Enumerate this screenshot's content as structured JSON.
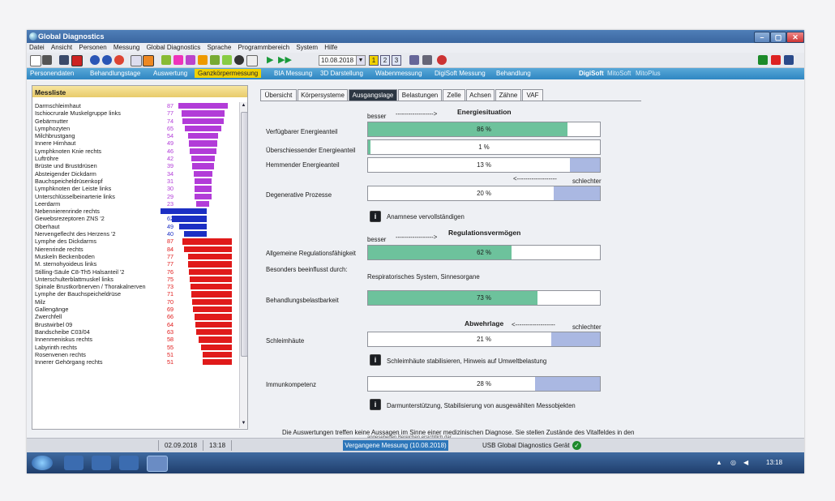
{
  "window": {
    "title": "Global Diagnostics",
    "buttons": [
      "–",
      "▢",
      "✕"
    ]
  },
  "menu": [
    "Datei",
    "Ansicht",
    "Personen",
    "Messung",
    "Global Diagnostics",
    "Sprache",
    "Programmbereich",
    "System",
    "Hilfe"
  ],
  "toolbar": {
    "date": "10.08.2018",
    "pages": [
      "1",
      "2",
      "3"
    ]
  },
  "nav": {
    "tabs": [
      "Personendaten",
      "Behandlungstage",
      "Auswertung",
      "Ganzkörpermessung",
      "BIA Messung",
      "3D Darstellung",
      "Wabenmessung",
      "DigiSoft Messung",
      "Behandlung"
    ],
    "active": "Ganzkörpermessung",
    "right": [
      "DigiSoft",
      "MitoSoft",
      "MitoPlus"
    ]
  },
  "messliste": {
    "title": "Messliste",
    "rows": [
      {
        "name": "Darmschleimhaut",
        "value": 87,
        "color": "#b23cd8"
      },
      {
        "name": "Ischiocrurale Muskelgruppe links",
        "value": 77,
        "color": "#b23cd8"
      },
      {
        "name": "Gebärmutter",
        "value": 74,
        "color": "#b23cd8"
      },
      {
        "name": "Lymphozyten",
        "value": 65,
        "color": "#b23cd8"
      },
      {
        "name": "Milchbrustgang",
        "value": 54,
        "color": "#b23cd8"
      },
      {
        "name": "Innere Hirnhaut",
        "value": 49,
        "color": "#b23cd8"
      },
      {
        "name": "Lymphknoten Knie rechts",
        "value": 46,
        "color": "#b23cd8"
      },
      {
        "name": "Luftröhre",
        "value": 42,
        "color": "#b23cd8"
      },
      {
        "name": "Brüste und Brustdrüsen",
        "value": 39,
        "color": "#b23cd8"
      },
      {
        "name": "Absteigender Dickdarm",
        "value": 34,
        "color": "#b23cd8"
      },
      {
        "name": "Bauchspeicheldrüsenkopf",
        "value": 31,
        "color": "#b23cd8"
      },
      {
        "name": "Lymphknoten der Leiste links",
        "value": 30,
        "color": "#b23cd8"
      },
      {
        "name": "Unterschlüsselbeinarterie links",
        "value": 29,
        "color": "#b23cd8"
      },
      {
        "name": "Leerdarm",
        "value": 23,
        "color": "#b23cd8"
      },
      {
        "name": "Nebennierenrinde rechts",
        "value": 82,
        "color": "#1c2fc4"
      },
      {
        "name": "Gewebsrezeptoren ZNS '2",
        "value": 62,
        "color": "#1c2fc4"
      },
      {
        "name": "Oberhaut",
        "value": 49,
        "color": "#1c2fc4"
      },
      {
        "name": "Nervengeflecht des Herzens '2",
        "value": 40,
        "color": "#1c2fc4"
      },
      {
        "name": "Lymphe des Dickdarms",
        "value": 87,
        "color": "#e01a1a"
      },
      {
        "name": "Nierenrinde rechts",
        "value": 84,
        "color": "#e01a1a"
      },
      {
        "name": "Muskeln Beckenboden",
        "value": 77,
        "color": "#e01a1a"
      },
      {
        "name": "M. sternohyoideus links",
        "value": 77,
        "color": "#e01a1a"
      },
      {
        "name": "Stilling-Säule C8-Th5 Halsanteil '2",
        "value": 76,
        "color": "#e01a1a"
      },
      {
        "name": "Unterschulterblattmuskel links",
        "value": 75,
        "color": "#e01a1a"
      },
      {
        "name": "Spinale Brustkorbnerven / Thorakalnerven",
        "value": 73,
        "color": "#e01a1a"
      },
      {
        "name": "Lymphe der Bauchspeicheldrüse",
        "value": 71,
        "color": "#e01a1a"
      },
      {
        "name": "Milz",
        "value": 70,
        "color": "#e01a1a"
      },
      {
        "name": "Gallengänge",
        "value": 69,
        "color": "#e01a1a"
      },
      {
        "name": "Zwerchfell",
        "value": 66,
        "color": "#e01a1a"
      },
      {
        "name": "Brustwirbel 09",
        "value": 64,
        "color": "#e01a1a"
      },
      {
        "name": "Bandscheibe C03/04",
        "value": 63,
        "color": "#e01a1a"
      },
      {
        "name": "Innenmeniskus rechts",
        "value": 58,
        "color": "#e01a1a"
      },
      {
        "name": "Labyrinth rechts",
        "value": 55,
        "color": "#e01a1a"
      },
      {
        "name": "Rosenvenen rechts",
        "value": 51,
        "color": "#e01a1a"
      },
      {
        "name": "Innerer Gehörgang rechts",
        "value": 51,
        "color": "#e01a1a"
      }
    ]
  },
  "subtabs": [
    "Übersicht",
    "Körpersysteme",
    "Ausgangslage",
    "Belastungen",
    "Zelle",
    "Achsen",
    "Zähne",
    "VAF"
  ],
  "subtab_active": "Ausgangslage",
  "energie": {
    "title": "Energiesituation",
    "besser": "besser",
    "arrow_right": "------------------>",
    "arrow_left": "<-------------------",
    "schlechter": "schlechter",
    "items": [
      {
        "label": "Verfügbarer Energieanteil",
        "pct": "86 %",
        "value": 86,
        "kind": "green"
      },
      {
        "label": "Überschiessender Energieanteil",
        "pct": "1 %",
        "value": 1,
        "kind": "green"
      },
      {
        "label": "Hemmender Energieanteil",
        "pct": "13 %",
        "value": 13,
        "kind": "blue"
      },
      {
        "label": "Degenerative Prozesse",
        "pct": "20 %",
        "value": 20,
        "kind": "blue"
      }
    ],
    "note": "Anamnese vervollständigen"
  },
  "regulation": {
    "title": "Regulationsvermögen",
    "besser": "besser",
    "arrow_right": "------------------>",
    "allgemein": {
      "label": "Allgemeine Regulationsfähigkeit",
      "pct": "62 %",
      "value": 62
    },
    "beeinflusst_label": "Besonders beeinflusst durch:",
    "beeinflusst_value": "Respiratorisches System, Sinnesorgane",
    "belastbarkeit": {
      "label": "Behandlungsbelastbarkeit",
      "pct": "73 %",
      "value": 73
    }
  },
  "abwehr": {
    "title": "Abwehrlage",
    "arrow_left": "<-------------------",
    "schlechter": "schlechter",
    "schleimhaeute": {
      "label": "Schleimhäute",
      "pct": "21 %",
      "value": 21
    },
    "note1": "Schleimhäute stabilisieren, Hinweis auf Umweltbelastung",
    "immun": {
      "label": "Immunkompetenz",
      "pct": "28 %",
      "value": 28
    },
    "note2": "Darmunterstützung, Stabilisierung von ausgewählten Messobjekten"
  },
  "disclaimer": {
    "line1": "Die Auswertungen treffen keine Aussagen im Sinne einer medizinischen Diagnose. Sie stellen Zustände des Vitalfeldes in den",
    "line2": "angesehenen Bereichen ersichtlich dar"
  },
  "status": {
    "date": "02.09.2018",
    "time": "13:18",
    "measurement": "Vergangene Messung (10.08.2018)",
    "device": "USB Global Diagnostics Gerät"
  },
  "taskbar": {
    "clock": "13:18"
  },
  "colors": {
    "green": "#6dc29c",
    "blue": "#aab8e2",
    "purple": "#b23cd8",
    "darkblue": "#1c2fc4",
    "red": "#e01a1a",
    "nav_active": "#f0d100"
  }
}
